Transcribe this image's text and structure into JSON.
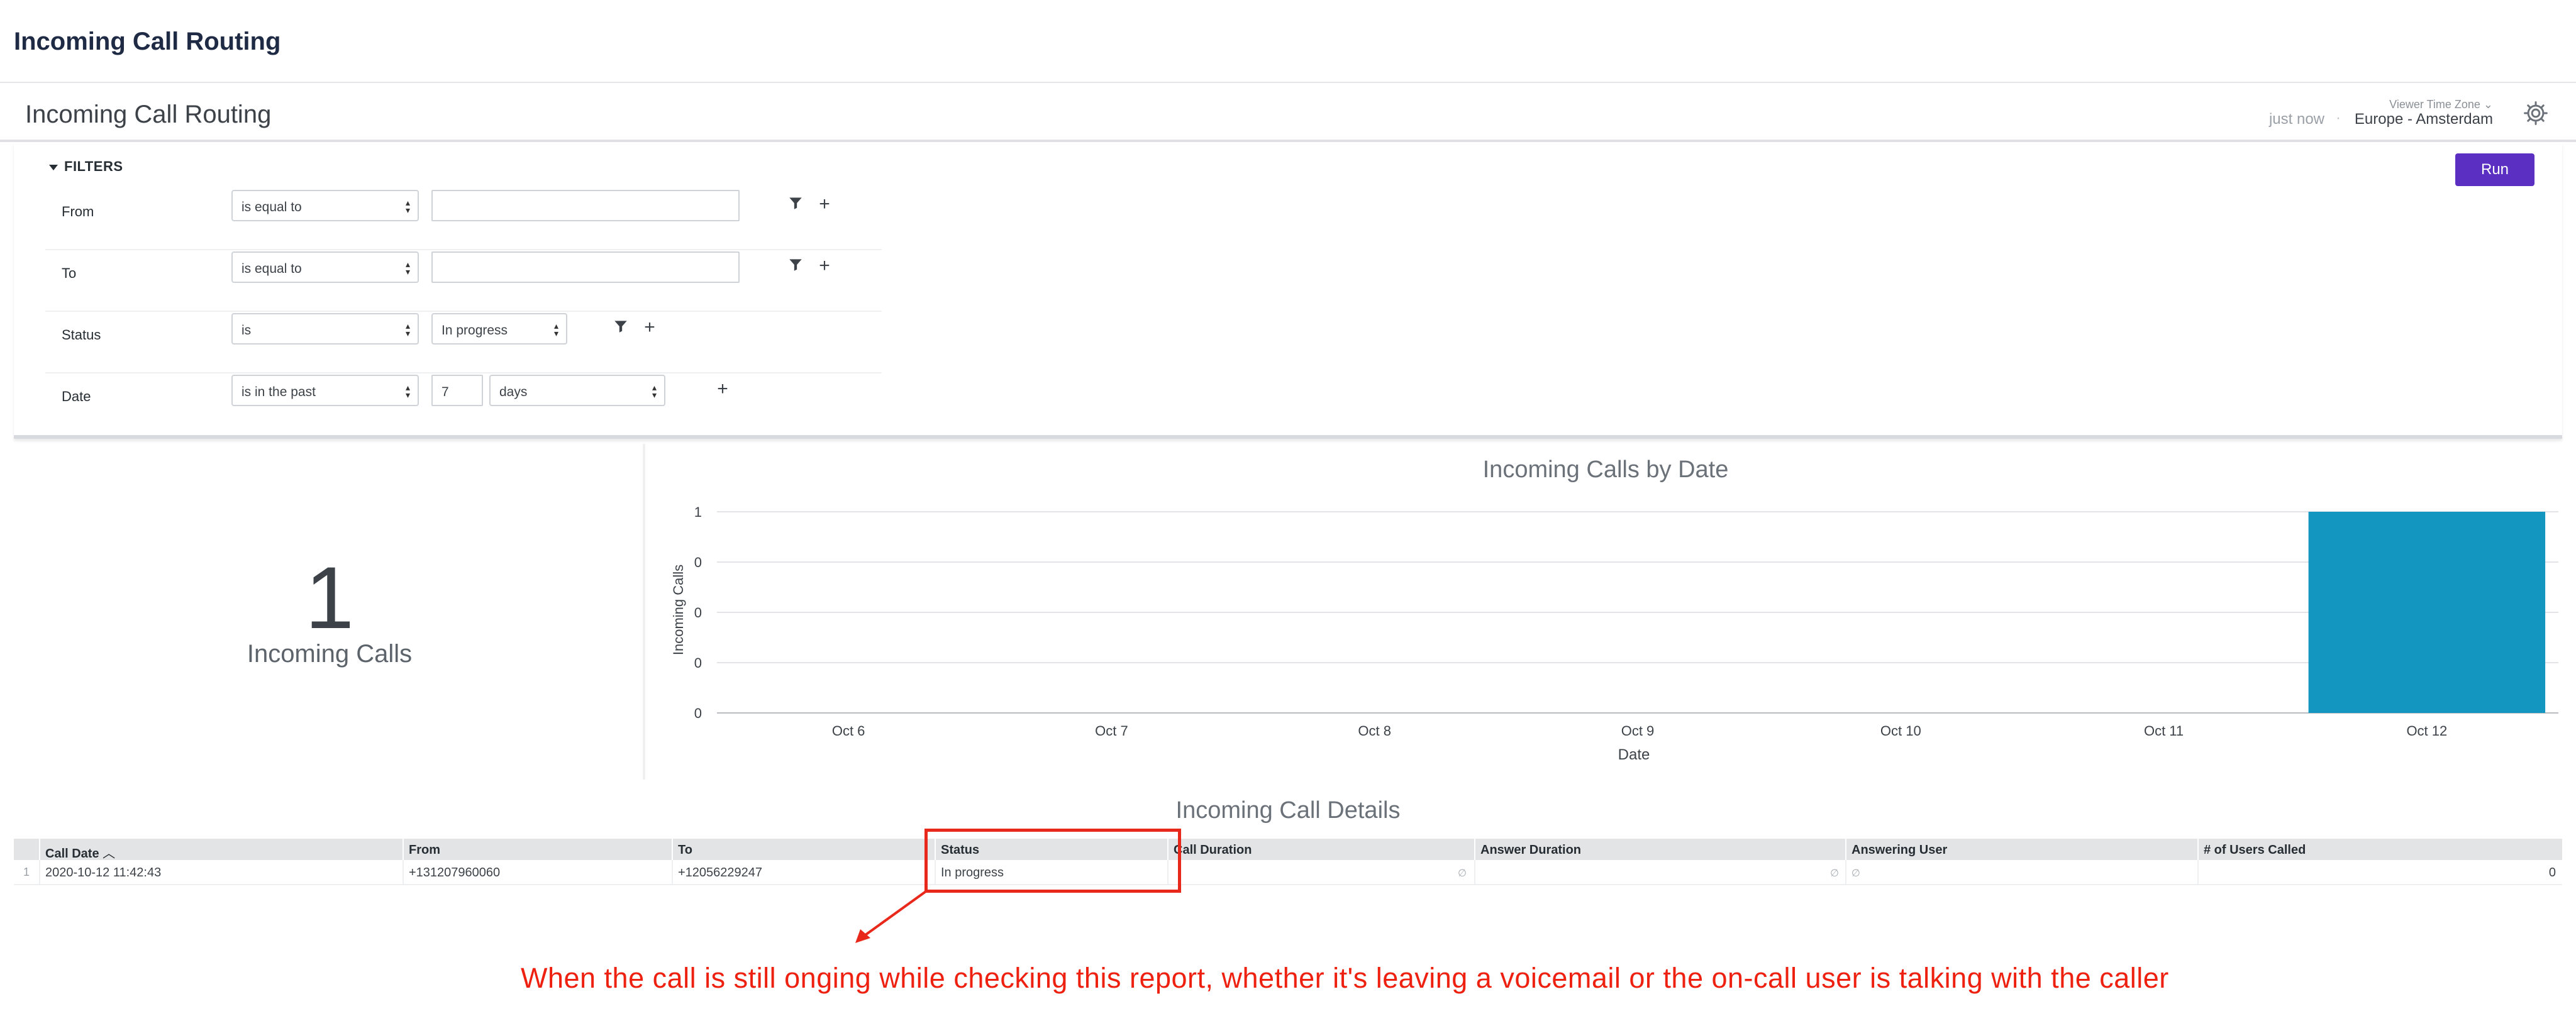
{
  "app": {
    "title": "Incoming Call Routing"
  },
  "dashboard": {
    "title": "Incoming Call Routing",
    "timezone_label": "Viewer Time Zone",
    "timezone_value": "Europe - Amsterdam",
    "last_run": "just now",
    "separator": "·"
  },
  "filters": {
    "toggle_label": "FILTERS",
    "run_label": "Run",
    "rows": [
      {
        "label": "From",
        "operator": "is equal to",
        "value": ""
      },
      {
        "label": "To",
        "operator": "is equal to",
        "value": ""
      },
      {
        "label": "Status",
        "operator": "is",
        "value": "In progress"
      },
      {
        "label": "Date",
        "operator": "is in the past",
        "value": "7",
        "unit": "days"
      }
    ]
  },
  "kpi": {
    "value": "1",
    "label": "Incoming Calls"
  },
  "chart_data": {
    "type": "bar",
    "title": "Incoming Calls by Date",
    "xlabel": "Date",
    "ylabel": "Incoming Calls",
    "categories": [
      "Oct 6",
      "Oct 7",
      "Oct 8",
      "Oct 9",
      "Oct 10",
      "Oct 11",
      "Oct 12"
    ],
    "values": [
      0,
      0,
      0,
      0,
      0,
      0,
      1
    ],
    "y_tick_labels": [
      "1",
      "0",
      "0",
      "0",
      "0"
    ],
    "ylim": [
      0,
      1
    ],
    "grid": true,
    "bar_color": "#1396bf"
  },
  "table": {
    "title": "Incoming Call Details",
    "columns": [
      "Call Date",
      "From",
      "To",
      "Status",
      "Call Duration",
      "Answer Duration",
      "Answering User",
      "# of Users Called"
    ],
    "sort_indicator": "^",
    "rows": [
      {
        "index": "1",
        "call_date": "2020-10-12 11:42:43",
        "from": "+131207960060",
        "to": "+12056229247",
        "status": "In progress",
        "call_duration": "∅",
        "answer_duration": "∅",
        "answering_user": "∅",
        "users_called": "0"
      }
    ]
  },
  "annotation": {
    "text": "When the call is still onging while checking this report, whether it's leaving a voicemail or the on-call user is talking with the caller",
    "color": "#ee2111"
  }
}
